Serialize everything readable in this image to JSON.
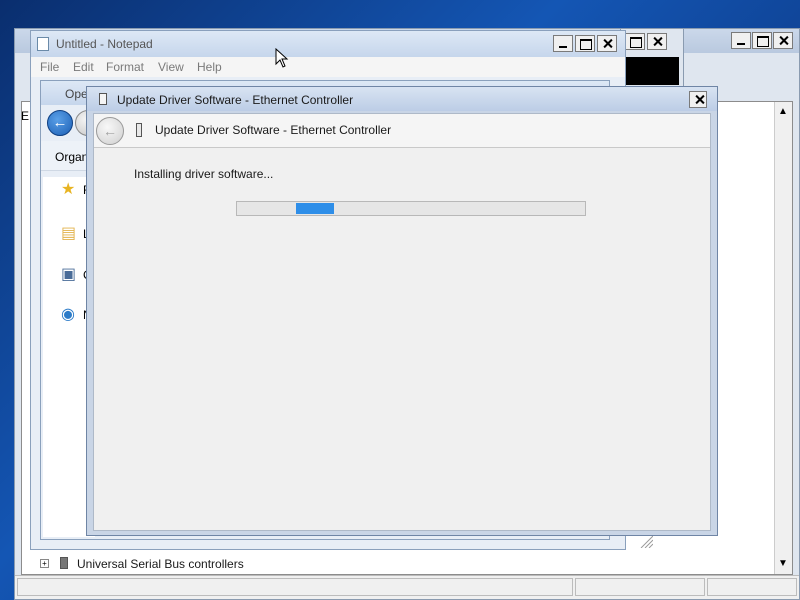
{
  "notepad": {
    "title": "Untitled - Notepad",
    "menu": [
      "File",
      "Edit",
      "Format",
      "View",
      "Help"
    ]
  },
  "explorer": {
    "title_fragment": "Ope",
    "toolbar_fragment": "Organ",
    "left_body_fragment": "E",
    "nav_items": [
      {
        "icon": "star-icon",
        "letter": "F"
      },
      {
        "icon": "libraries-icon",
        "letter": "L"
      },
      {
        "icon": "computer-icon",
        "letter": "C"
      },
      {
        "icon": "network-icon",
        "letter": "N"
      }
    ]
  },
  "dialog": {
    "title": "Update Driver Software - Ethernet Controller",
    "header": "Update Driver Software - Ethernet Controller",
    "status": "Installing driver software...",
    "progress_start": 0.17,
    "progress_width": 0.11
  },
  "device_manager": {
    "tree_item": "Universal Serial Bus controllers"
  },
  "colors": {
    "progress_fill": "#2e8ee8",
    "desktop": "#1456b4"
  }
}
